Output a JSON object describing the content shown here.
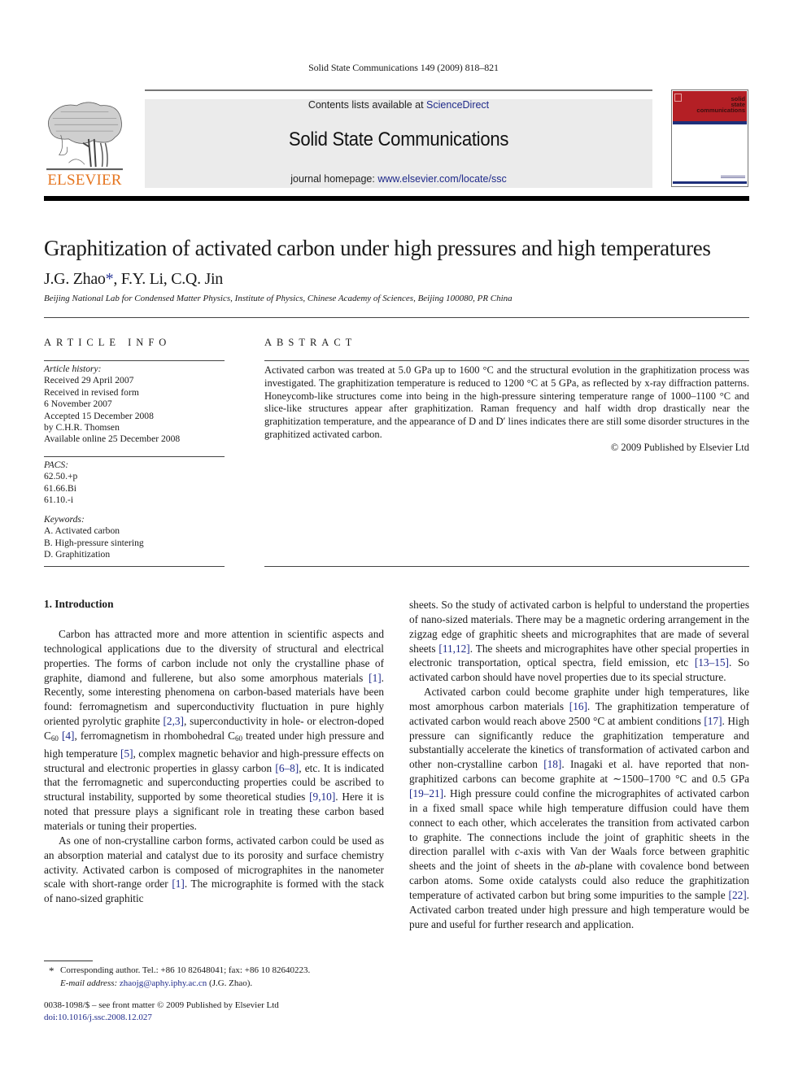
{
  "running_head": "Solid State Communications 149 (2009) 818–821",
  "header": {
    "publisher_wordmark": "ELSEVIER",
    "contents_prefix": "Contents lists available at ",
    "contents_link": "ScienceDirect",
    "journal_title": "Solid State Communications",
    "homepage_prefix": "journal homepage: ",
    "homepage_link": "www.elsevier.com/locate/ssc",
    "cover_title_lines": [
      "solid",
      "state",
      "communications"
    ],
    "colors": {
      "wordmark": "#e5751f",
      "cover_red": "#b41f25",
      "cover_blue": "#1e2f7a",
      "link": "#1f2a8a",
      "banner_bg": "#ebebeb"
    }
  },
  "article": {
    "title": "Graphitization of activated carbon under high pressures and high temperatures",
    "authors": {
      "first": "J.G. Zhao",
      "star": "*",
      "rest": ", F.Y. Li, C.Q. Jin"
    },
    "affiliation": "Beijing National Lab for Condensed Matter Physics, Institute of Physics, Chinese Academy of Sciences, Beijing 100080, PR China"
  },
  "article_info": {
    "heading": "ARTICLE INFO",
    "history_label": "Article history:",
    "history": [
      "Received 29 April 2007",
      "Received in revised form",
      "6 November 2007",
      "Accepted 15 December 2008",
      "by C.H.R. Thomsen",
      "Available online 25 December 2008"
    ],
    "pacs_label": "PACS:",
    "pacs": [
      "62.50.+p",
      "61.66.Bi",
      "61.10.-i"
    ],
    "keywords_label": "Keywords:",
    "keywords": [
      "A. Activated carbon",
      "B. High-pressure sintering",
      "D. Graphitization"
    ]
  },
  "abstract": {
    "heading": "ABSTRACT",
    "text": "Activated carbon was treated at 5.0 GPa up to 1600 °C and the structural evolution in the graphitization process was investigated. The graphitization temperature is reduced to 1200 °C at 5 GPa, as reflected by x-ray diffraction patterns. Honeycomb-like structures come into being in the high-pressure sintering temperature range of 1000–1100 °C and slice-like structures appear after graphitization. Raman frequency and half width drop drastically near the graphitization temperature, and the appearance of D and D′ lines indicates there are still some disorder structures in the graphitized activated carbon.",
    "copyright": "© 2009 Published by Elsevier Ltd"
  },
  "section1": {
    "heading": "1.  Introduction",
    "p1": {
      "a": "Carbon has attracted more and more attention in scientific aspects and technological applications due to the diversity of structural and electrical properties. The forms of carbon include not only the crystalline phase of graphite, diamond and fullerene, but also some amorphous materials ",
      "r1": "[1]",
      "b": ". Recently, some interesting phenomena on carbon-based materials have been found: ferromagnetism and superconductivity fluctuation in pure highly oriented pyrolytic graphite ",
      "r2": "[2,3]",
      "c": ", superconductivity in hole- or electron-doped C",
      "sub1": "60",
      "r3": " [4]",
      "d": ", ferromagnetism in rhombohedral C",
      "sub2": "60",
      "e": " treated under high pressure and high temperature ",
      "r4": "[5]",
      "f": ", complex magnetic behavior and high-pressure effects on structural and electronic properties in glassy carbon ",
      "r5": "[6–8]",
      "g": ", etc. It is indicated that the ferromagnetic and superconducting properties could be ascribed to structural instability, supported by some theoretical studies ",
      "r6": "[9,10]",
      "h": ". Here it is noted that pressure plays a significant role in treating these carbon based materials or tuning their properties."
    },
    "p2": {
      "a": "As one of non-crystalline carbon forms, activated carbon could be used as an absorption material and catalyst due to its porosity and surface chemistry activity. Activated carbon is composed of micrographites in the nanometer scale with short-range order ",
      "r1": "[1]",
      "b": ". The micrographite is formed with the stack of nano-sized graphitic sheets. So the study of activated carbon is helpful to understand the properties of nano-sized materials. There may be a magnetic ordering arrangement in the zigzag edge of graphitic sheets and micrographites that are made of several sheets ",
      "r2": "[11,12]",
      "c": ". The sheets and micrographites have other special properties in electronic transportation, optical spectra, field emission, etc ",
      "r3": "[13–15]",
      "d": ". So activated carbon should have novel properties due to its special structure."
    },
    "p3": {
      "a": "Activated carbon could become graphite under high temperatures, like most amorphous carbon materials ",
      "r1": "[16]",
      "b": ". The graphitization temperature of activated carbon would reach above 2500 °C at ambient conditions ",
      "r2": "[17]",
      "c": ". High pressure can significantly reduce the graphitization temperature and substantially accelerate the kinetics of transformation of activated carbon and other non-crystalline carbon ",
      "r3": "[18]",
      "d": ". Inagaki et al. have reported that non-graphitized carbons can become graphite at ∼1500–1700 °C and 0.5 GPa ",
      "r4": "[19–21]",
      "e": ". High pressure could confine the micrographites of activated carbon in a fixed small space while high temperature diffusion could have them connect to each other, which accelerates the transition from activated carbon to graphite. The connections include the joint of graphitic sheets in the direction parallel with ",
      "i1": "c",
      "f": "-axis with Van der Waals force between graphitic sheets and the joint of sheets in the ",
      "i2": "ab",
      "g": "-plane with covalence bond between carbon atoms. Some oxide catalysts could also reduce the graphitization temperature of activated carbon but bring some impurities to the sample ",
      "r5": "[22]",
      "h": ". Activated carbon treated under high pressure and high temperature would be pure and useful for further research and application."
    }
  },
  "footnote": {
    "star": "*",
    "line1": "Corresponding author. Tel.: +86 10 82648041; fax: +86 10 82640223.",
    "email_label": "E-mail address: ",
    "email": "zhaojg@aphy.iphy.ac.cn",
    "email_suffix": " (J.G. Zhao)."
  },
  "front_matter": {
    "issn": "0038-1098/$ – see front matter © 2009 Published by Elsevier Ltd",
    "doi": "doi:10.1016/j.ssc.2008.12.027"
  }
}
